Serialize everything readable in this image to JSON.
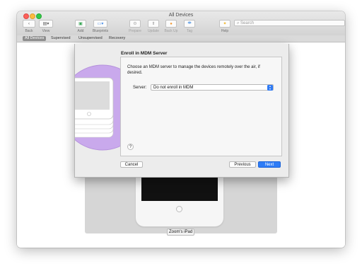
{
  "window": {
    "title": "All Devices"
  },
  "toolbar": {
    "back_label": "Back",
    "view_label": "View",
    "add_label": "Add",
    "blueprints_label": "Blueprints",
    "prepare_label": "Prepare",
    "update_label": "Update",
    "backup_label": "Back Up",
    "tag_label": "Tag",
    "help_label": "Help",
    "search_placeholder": "Search"
  },
  "tabs": [
    "All Devices",
    "Supervised",
    "Unsupervised",
    "Recovery"
  ],
  "active_tab": "All Devices",
  "sheet": {
    "title": "Enroll in MDM Server",
    "description": "Choose an MDM server to manage the devices remotely over the air, if desired.",
    "server_label": "Server:",
    "server_value": "Do not enroll in MDM",
    "help_label": "?",
    "cancel_label": "Cancel",
    "previous_label": "Previous",
    "next_label": "Next"
  },
  "device": {
    "name": "Zoom's iPad"
  },
  "colors": {
    "accent": "#2e7cf6",
    "art_circle": "#c9a9ec",
    "close": "#fc605b",
    "minimize": "#fdbc40",
    "maximize": "#34c84a"
  }
}
